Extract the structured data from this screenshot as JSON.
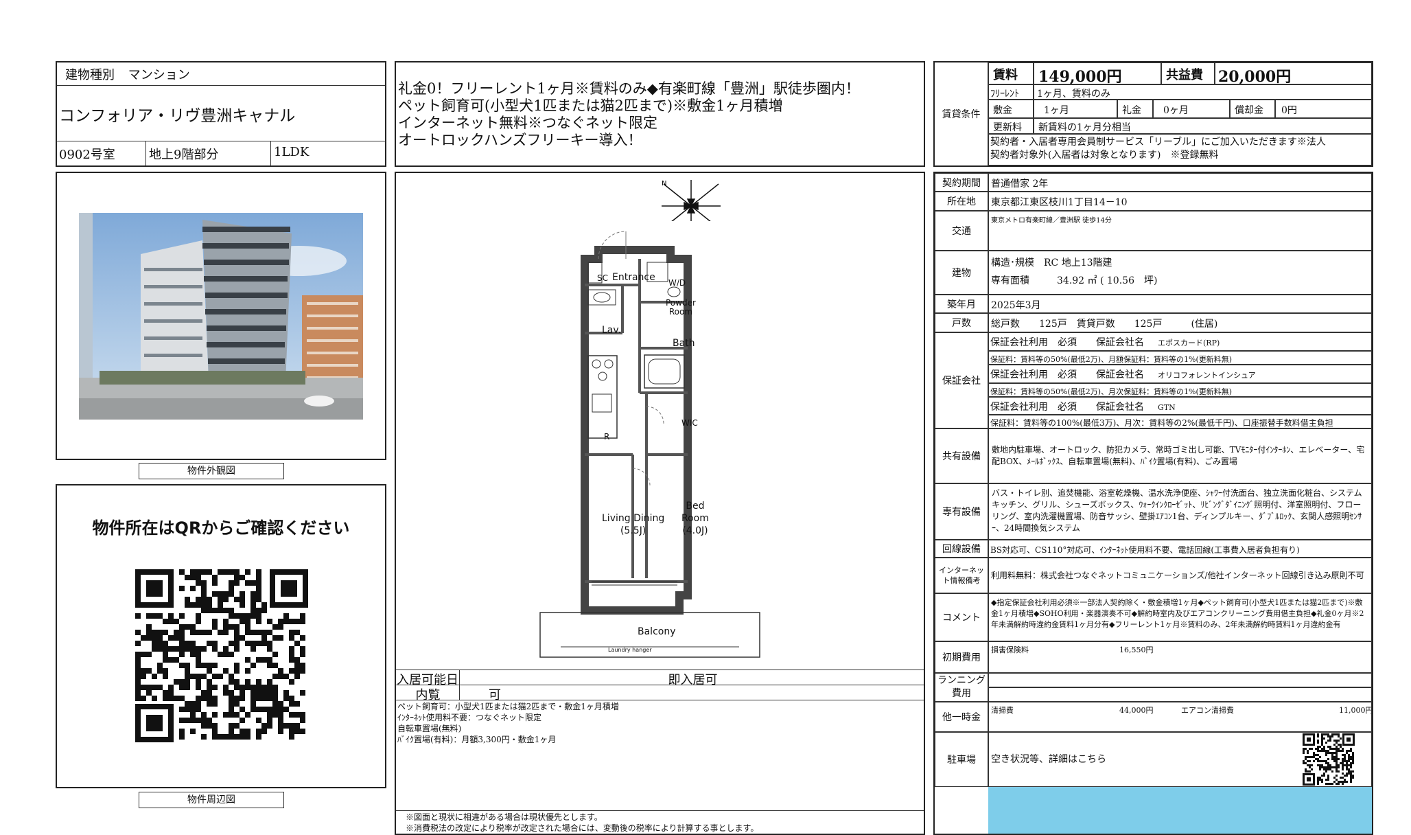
{
  "building": {
    "type_label": "建物種別",
    "type_value": "マンション",
    "name": "コンフォリア・リヴ豊洲キャナル",
    "room": "0902号室",
    "floor": "地上9階部分",
    "layout": "1LDK"
  },
  "headline": [
    "礼金0！フリーレント1ヶ月※賃料のみ◆有楽町線「豊洲」駅徒歩圏内！",
    "ペット飼育可(小型犬1匹または猫2匹まで)※敷金1ヶ月積増",
    "インターネット無料※つなぐネット限定",
    "オートロックハンズフリーキー導入！"
  ],
  "photo": {
    "caption": "物件外観図"
  },
  "map": {
    "heading": "物件所在はQRからご確認ください",
    "caption": "物件周辺図"
  },
  "floorplan": {
    "rooms": {
      "sc": "SC",
      "entrance": "Entrance",
      "wd": "W/D",
      "powder1": "Powder",
      "powder2": "Room",
      "lav": "Lav.",
      "bath": "Bath",
      "wic": "WIC",
      "r": "R",
      "living1": "Living Dining",
      "living2": "(5.5J)",
      "bed1": "Bed",
      "bed2": "Room",
      "bed3": "(4.0J)",
      "balcony": "Balcony",
      "laundry": "Laundry hanger"
    }
  },
  "availability": {
    "move_in_label": "入居可能日",
    "move_in_value": "即入居可",
    "viewing_label": "内覧",
    "viewing_value": "可"
  },
  "notes": [
    "ペット飼育可：小型犬1匹または猫2匹まで・敷金1ヶ月積増",
    "ｲﾝﾀｰﾈｯﾄ使用料不要：つなぐネット限定",
    "自転車置場(無料)",
    "ﾊﾞｲｸ置場(有料)：月額3,300円・敷金1ヶ月"
  ],
  "disclaimers": [
    "※図面と現状に相違がある場合は現状優先とします。",
    "※消費税法の改定により税率が改定された場合には、変動後の税率により計算する事とします。"
  ],
  "terms": {
    "section_label": "賃貸条件",
    "rent_label": "賃料",
    "rent_value": "149,000円",
    "fee_label": "共益費",
    "fee_value": "20,000円",
    "free_rent_label": "ﾌﾘｰﾚﾝﾄ",
    "free_rent_value": "1ヶ月、賃料のみ",
    "deposit_label": "敷金",
    "deposit_value": "1ヶ月",
    "key_money_label": "礼金",
    "key_money_value": "0ヶ月",
    "amortization_label": "償却金",
    "amortization_value": "0円",
    "renewal_label": "更新料",
    "renewal_value": "新賃料の1ヶ月分相当",
    "note1": "契約者・入居者専用会員制サービス「リーブル」にご加入いただきます※法人",
    "note2": "契約者対象外(入居者は対象となります)　※登録無料"
  },
  "details": {
    "contract_label": "契約期間",
    "contract_value": "普通借家 2年",
    "address_label": "所在地",
    "address_value": "東京都江東区枝川1丁目14－10",
    "transport_label": "交通",
    "transport_value": "東京メトロ有楽町線／豊洲駅 徒歩14分",
    "building_label": "建物",
    "structure_label": "構造･規模",
    "structure_value": "RC 地上13階建",
    "area_label": "専有面積",
    "area_value": "34.92 ㎡ ( 10.56　坪)",
    "built_label": "築年月",
    "built_value": "2025年3月",
    "units_label": "戸数",
    "units_value": "総戸数　　125戸　賃貸戸数　　125戸　　　(住居)",
    "guarantee_label": "保証会社",
    "guarantees": [
      {
        "use": "保証会社利用　必須　　保証会社名",
        "name": "エポスカード(RP)",
        "fee": "保証料：賃料等の50%(最低2万)、月額保証料：賃料等の1%(更新料無)"
      },
      {
        "use": "保証会社利用　必須　　保証会社名",
        "name": "オリコフォレントインシュア",
        "fee": "保証料：賃料等の50%(最低2万)、月次保証料：賃料等の1%(更新料無)"
      },
      {
        "use": "保証会社利用　必須　　保証会社名",
        "name": "GTN",
        "fee": "保証料：賃料等の100%(最低3万)、月次：賃料等の2%(最低千円)、口座振替手数料借主負担"
      }
    ],
    "shared_label": "共有設備",
    "shared_value": "敷地内駐車場、オートロック、防犯カメラ、常時ゴミ出し可能、TVﾓﾆﾀｰ付ｲﾝﾀｰﾎﾝ、エレベーター、宅配BOX、ﾒｰﾙﾎﾞｯｸｽ、自転車置場(無料)、ﾊﾞｲｸ置場(有料)、ごみ置場",
    "private_label": "専有設備",
    "private_value": "バス・トイレ別、追焚機能、浴室乾燥機、温水洗浄便座、ｼｬﾜｰ付洗面台、独立洗面化粧台、システムキッチン、グリル、シューズボックス、ｳｫｰｸｲﾝｸﾛｰｾﾞｯﾄ、ﾘﾋﾞﾝｸﾞﾀﾞｲﾆﾝｸﾞ照明付、洋室照明付、フローリング、室内洗濯機置場、防音サッシ、壁掛ｴｱｺﾝ1台、ディンプルキー、ﾀﾞﾌﾞﾙﾛｯｸ、玄関人感照明ｾﾝｻｰ、24時間換気システム",
    "line_label": "回線設備",
    "line_value": "BS対応可、CS110°対応可、ｲﾝﾀｰﾈｯﾄ使用料不要、電話回線(工事費入居者負担有り)",
    "internet_label1": "インターネッ",
    "internet_label2": "ト情報備考",
    "internet_value": "利用料無料：株式会社つなぐネットコミュニケーションズ/他社インターネット回線引き込み原則不可",
    "comment_label": "コメント",
    "comment_value": "◆指定保証会社利用必須※一部法人契約除く・敷金積増1ヶ月◆ペット飼育可(小型犬1匹または猫2匹まで)※敷金1ヶ月積増◆SOHO利用・楽器演奏不可◆解約時室内及びエアコンクリーニング費用借主負担◆礼金0ヶ月※2年未満解約時違約金賃料1ヶ月分有◆フリーレント1ヶ月※賃料のみ、2年未満解約時賃料1ヶ月違約金有",
    "initial_label": "初期費用",
    "initial_item": "損害保険料",
    "initial_value": "16,550円",
    "running_label1": "ランニング",
    "running_label2": "費用",
    "onetime_label": "他一時金",
    "cleaning_label": "清掃費",
    "cleaning_value": "44,000円",
    "aircon_label": "エアコン清掃費",
    "aircon_value": "11,000円",
    "parking_label": "駐車場",
    "parking_value": "空き状況等、詳細はこちら"
  }
}
